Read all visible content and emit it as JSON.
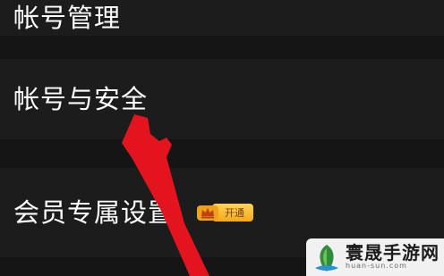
{
  "settings": {
    "items": [
      {
        "label": "帐号管理"
      },
      {
        "label": "帐号与安全"
      },
      {
        "label": "会员专属设置",
        "badge": "开通"
      }
    ]
  },
  "watermark": {
    "name": "寰晟手游网",
    "url": "huan-sun.com"
  },
  "colors": {
    "background": "#151515",
    "row": "#1c1c1c",
    "text": "#ffffff",
    "badge": "#f2a81d",
    "annotation_arrow": "#e3141e"
  },
  "icons": [
    "crown-icon",
    "pointer-arrow-annotation",
    "watermark-logo-icon"
  ]
}
